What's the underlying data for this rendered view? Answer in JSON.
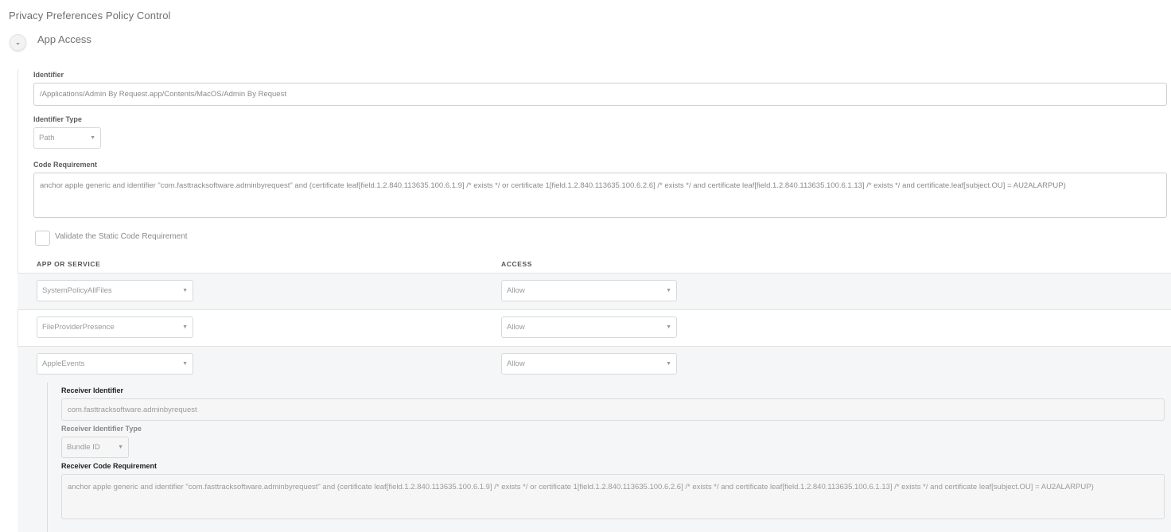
{
  "page": {
    "title": "Privacy Preferences Policy Control"
  },
  "section": {
    "title": "App Access",
    "toggle_icon": "chevron-down-icon"
  },
  "form": {
    "identifier_label": "Identifier",
    "identifier_value": "/Applications/Admin By Request.app/Contents/MacOS/Admin By Request",
    "identifier_type_label": "Identifier Type",
    "identifier_type_value": "Path",
    "code_requirement_label": "Code Requirement",
    "code_requirement_value": "anchor apple generic and identifier \"com.fasttracksoftware.adminbyrequest\" and (certificate leaf[field.1.2.840.113635.100.6.1.9] /* exists */ or certificate 1[field.1.2.840.113635.100.6.2.6] /* exists */ and certificate leaf[field.1.2.840.113635.100.6.1.13] /* exists */ and certificate.leaf[subject.OU] = AU2ALARPUP)",
    "validate_label": "Validate the Static Code Requirement",
    "validate_checked": false
  },
  "table": {
    "headers": {
      "service": "APP OR SERVICE",
      "access": "ACCESS"
    },
    "rows": [
      {
        "service": "SystemPolicyAllFiles",
        "access": "Allow"
      },
      {
        "service": "FileProviderPresence",
        "access": "Allow"
      },
      {
        "service": "AppleEvents",
        "access": "Allow"
      }
    ]
  },
  "receiver": {
    "identifier_label": "Receiver Identifier",
    "identifier_value": "com.fasttracksoftware.adminbyrequest",
    "identifier_type_label": "Receiver Identifier Type",
    "identifier_type_value": "Bundle ID",
    "code_requirement_label": "Receiver Code Requirement",
    "code_requirement_value": "anchor apple generic and identifier \"com.fasttracksoftware.adminbyrequest\" and (certificate leaf[field.1.2.840.113635.100.6.1.9] /* exists */ or certificate 1[field.1.2.840.113635.100.6.2.6] /* exists */ and certificate leaf[field.1.2.840.113635.100.6.1.13] /* exists */ and certificate leaf[subject.OU] = AU2ALARPUP)"
  }
}
